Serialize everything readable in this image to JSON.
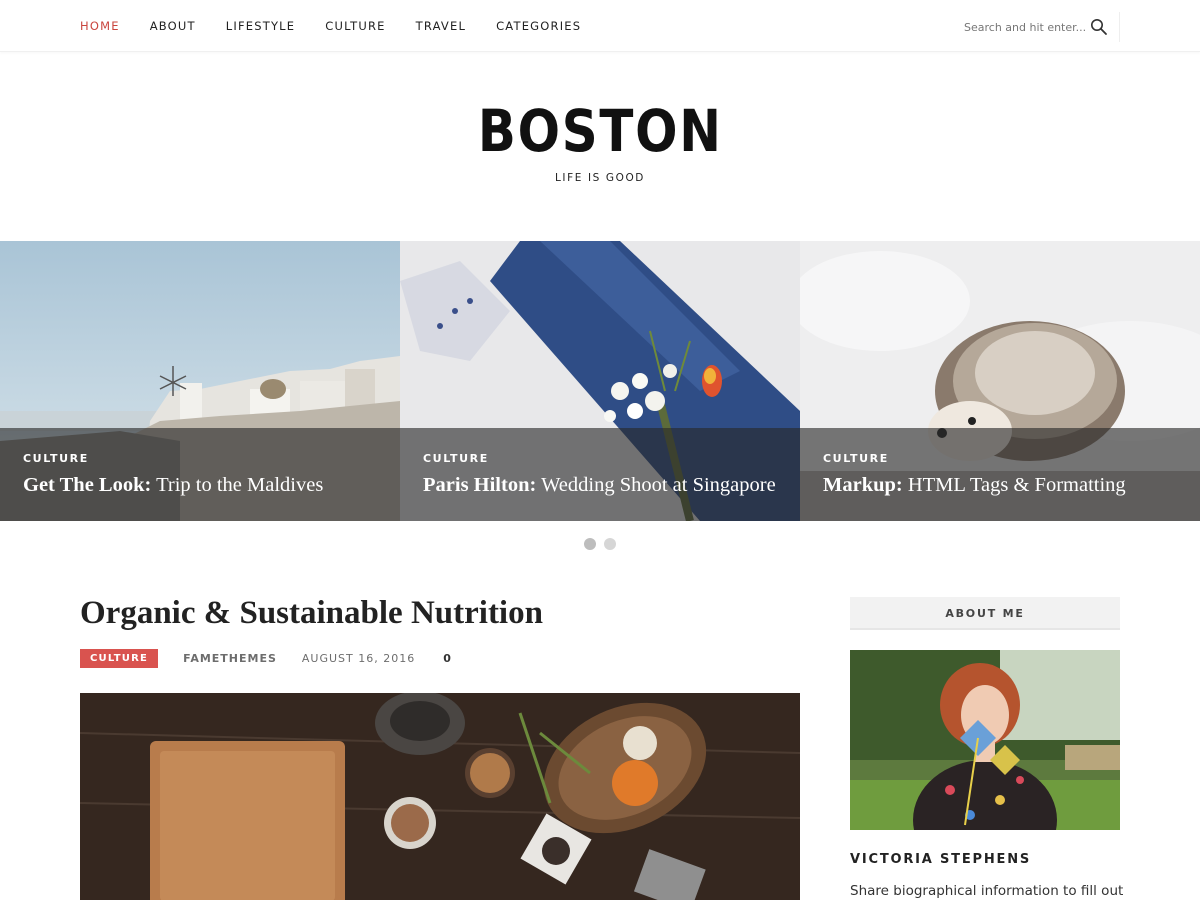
{
  "nav": {
    "items": [
      {
        "label": "HOME",
        "active": true
      },
      {
        "label": "ABOUT",
        "active": false
      },
      {
        "label": "LIFESTYLE",
        "active": false
      },
      {
        "label": "CULTURE",
        "active": false
      },
      {
        "label": "TRAVEL",
        "active": false
      },
      {
        "label": "CATEGORIES",
        "active": false
      }
    ],
    "search_placeholder": "Search and hit enter...",
    "search_icon": "search-icon"
  },
  "site": {
    "title": "BOSTON",
    "tagline": "LIFE IS GOOD"
  },
  "slider": {
    "slides": [
      {
        "category": "CULTURE",
        "title_bold": "Get The Look:",
        "title_rest": " Trip to the Maldives",
        "image": "santorini-village-photo"
      },
      {
        "category": "CULTURE",
        "title_bold": "Paris Hilton:",
        "title_rest": " Wedding Shoot at Singapore",
        "image": "boutonniere-photo"
      },
      {
        "category": "CULTURE",
        "title_bold": "Markup:",
        "title_rest": " HTML Tags & Formatting",
        "image": "hedgehog-photo"
      }
    ],
    "pagination": {
      "count": 2,
      "active_index": 0
    }
  },
  "post": {
    "title": "Organic & Sustainable Nutrition",
    "category": "CULTURE",
    "author": "FAMETHEMES",
    "date": "AUGUST 16, 2016",
    "comments": "0",
    "image": "kitchen-ingredients-photo"
  },
  "sidebar": {
    "widget_title": "ABOUT ME",
    "name": "VICTORIA STEPHENS",
    "bio": "Share biographical information to fill out",
    "image": "portrait-photo"
  },
  "colors": {
    "accent": "#c9453e",
    "badge": "#d9534f"
  }
}
